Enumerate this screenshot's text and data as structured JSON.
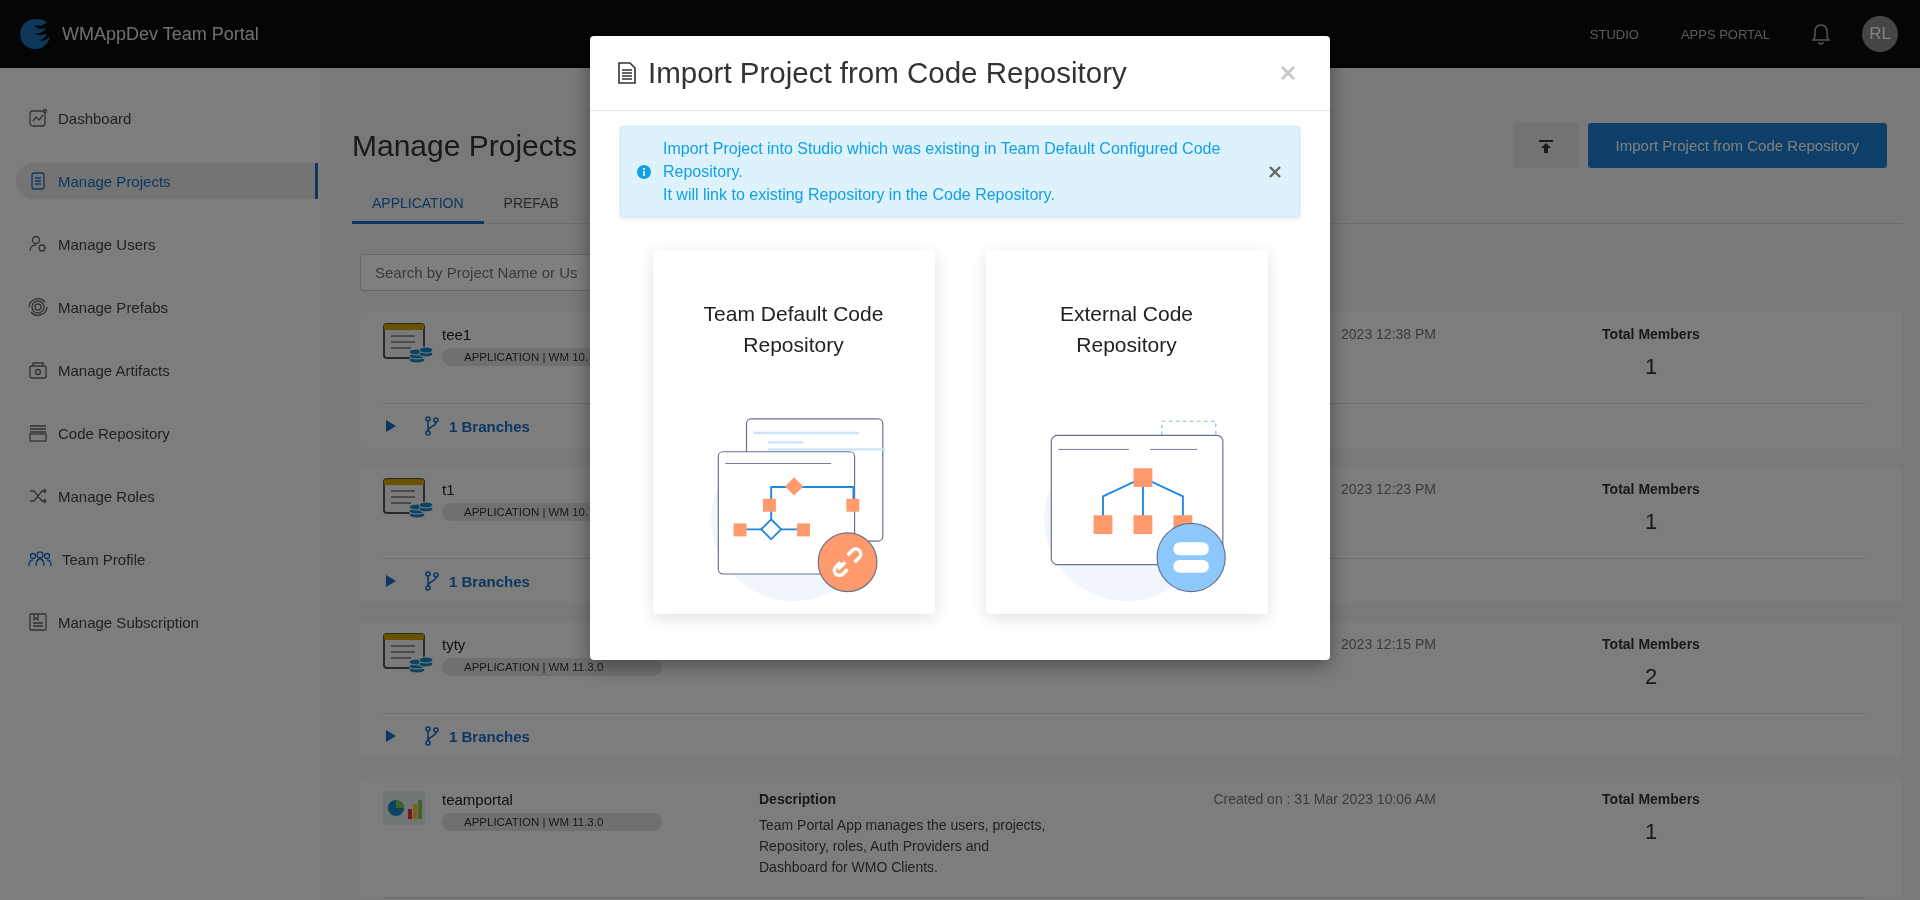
{
  "topbar": {
    "brand": "WMAppDev Team Portal",
    "nav": [
      {
        "label": "STUDIO"
      },
      {
        "label": "APPS PORTAL"
      }
    ],
    "avatar": "RL"
  },
  "sidebar": {
    "items": [
      {
        "label": "Dashboard",
        "kind": "dashboard",
        "selected": false
      },
      {
        "label": "Manage Projects",
        "kind": "projects",
        "selected": true
      },
      {
        "label": "Manage Users",
        "kind": "users",
        "selected": false
      },
      {
        "label": "Manage Prefabs",
        "kind": "prefabs",
        "selected": false
      },
      {
        "label": "Manage Artifacts",
        "kind": "artifacts",
        "selected": false
      },
      {
        "label": "Code Repository",
        "kind": "repository",
        "selected": false
      },
      {
        "label": "Manage Roles",
        "kind": "roles",
        "selected": false
      },
      {
        "label": "Team Profile",
        "kind": "team",
        "selected": false
      },
      {
        "label": "Manage Subscription",
        "kind": "subscription",
        "selected": false
      }
    ]
  },
  "page": {
    "title": "Manage Projects",
    "import_button": "Import Project from Code Repository",
    "tabs": [
      {
        "label": "APPLICATION",
        "selected": true
      },
      {
        "label": "PREFAB",
        "selected": false
      }
    ],
    "search": {
      "placeholder": "Search by Project Name or Us"
    }
  },
  "projects": [
    {
      "kind": "database",
      "name": "tee1",
      "badge": "APPLICATION | WM 10.",
      "created": "2023 12:38 PM",
      "members_label": "Total Members",
      "members": "1",
      "branches": "1 Branches"
    },
    {
      "kind": "database",
      "name": "t1",
      "badge": "APPLICATION | WM 10.",
      "created": "2023 12:23 PM",
      "members_label": "Total Members",
      "members": "1",
      "branches": "1 Branches"
    },
    {
      "kind": "database",
      "name": "tyty",
      "badge": "APPLICATION | WM 11.3.0",
      "created": "2023 12:15 PM",
      "members_label": "Total Members",
      "members": "2",
      "branches": "1 Branches"
    },
    {
      "kind": "chart",
      "name": "teamportal",
      "badge": "APPLICATION | WM 11.3.0",
      "description_label": "Description",
      "description": "Team Portal App manages the users, projects, Repository, roles, Auth Providers and Dashboard for WMO Clients.",
      "created": "Created on : 31 Mar 2023 10:06 AM",
      "members_label": "Total Members",
      "members": "1"
    }
  ],
  "modal": {
    "title": "Import Project from Code Repository",
    "alert": {
      "lines": [
        "Import Project into Studio which was existing in Team Default Configured Code Repository.",
        "It will link to existing Repository in the Code Repository."
      ]
    },
    "options": [
      {
        "kind": "team-default",
        "title": "Team Default Code Repository"
      },
      {
        "kind": "external",
        "title": "External Code Repository"
      }
    ]
  }
}
